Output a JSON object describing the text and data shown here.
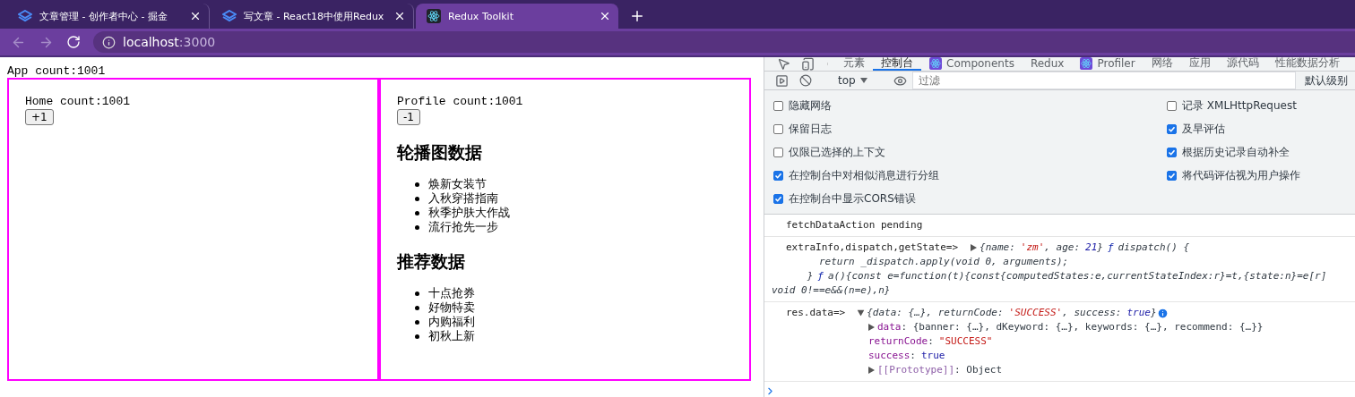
{
  "browser": {
    "tabs": [
      {
        "title": "文章管理 - 创作者中心 - 掘金",
        "selected": false
      },
      {
        "title": "写文章 - React18中使用Redux",
        "selected": false
      },
      {
        "title": "Redux Toolkit",
        "selected": true
      }
    ],
    "address": {
      "host": "localhost",
      "port": ":3000"
    }
  },
  "page": {
    "app_count": "App count:1001",
    "home": {
      "count": "Home count:1001",
      "button": "+1"
    },
    "profile": {
      "count": "Profile count:1001",
      "button": "-1",
      "banner_title": "轮播图数据",
      "banners": [
        "焕新女装节",
        "入秋穿搭指南",
        "秋季护肤大作战",
        "流行抢先一步"
      ],
      "recommend_title": "推荐数据",
      "recommends": [
        "十点抢券",
        "好物特卖",
        "内购福利",
        "初秋上新"
      ]
    }
  },
  "devtools": {
    "tabs": [
      {
        "label": "元素",
        "selected": false
      },
      {
        "label": "控制台",
        "selected": true
      },
      {
        "label": "Components",
        "selected": false
      },
      {
        "label": "Redux",
        "selected": false
      },
      {
        "label": "Profiler",
        "selected": false
      },
      {
        "label": "网络",
        "selected": false
      },
      {
        "label": "应用",
        "selected": false
      },
      {
        "label": "源代码",
        "selected": false
      },
      {
        "label": "性能数据分析",
        "selected": false
      }
    ],
    "toolbar": {
      "context": "top",
      "filter_placeholder": "过滤",
      "levels": "默认级别"
    },
    "settings": {
      "left": [
        {
          "label": "隐藏网络",
          "checked": false
        },
        {
          "label": "保留日志",
          "checked": false
        },
        {
          "label": "仅限已选择的上下文",
          "checked": false
        },
        {
          "label": "在控制台中对相似消息进行分组",
          "checked": true
        },
        {
          "label": "在控制台中显示CORS错误",
          "checked": true
        }
      ],
      "right": [
        {
          "label": "记录 XMLHttpRequest",
          "checked": false
        },
        {
          "label": "及早评估",
          "checked": true
        },
        {
          "label": "根据历史记录自动补全",
          "checked": true
        },
        {
          "label": "将代码评估视为用户操作",
          "checked": true
        }
      ]
    },
    "messages": [
      {
        "lines": [
          {
            "kind": "entry",
            "segments": [
              {
                "kind": "label",
                "text": "fetchDataAction pending"
              }
            ]
          }
        ]
      },
      {
        "lines": [
          {
            "kind": "entry",
            "segments": [
              {
                "kind": "label",
                "text": "extraInfo,dispatch,getState=>"
              },
              {
                "kind": "toggle",
                "expanded": false
              },
              {
                "kind": "plain",
                "text": "{name:"
              },
              {
                "kind": "string",
                "text": "'zm'"
              },
              {
                "kind": "plain",
                "text": ", age:"
              },
              {
                "kind": "number",
                "text": "21"
              },
              {
                "kind": "plain",
                "text": "}"
              },
              {
                "kind": "func",
                "text": "ƒ"
              },
              {
                "kind": "plain",
                "text": "dispatch() {"
              }
            ]
          },
          {
            "kind": "source",
            "segments": [
              {
                "kind": "plain",
                "text": "        return _dispatch.apply(void 0, arguments);"
              }
            ]
          },
          {
            "kind": "source",
            "segments": [
              {
                "kind": "plain",
                "text": "      }"
              },
              {
                "kind": "func",
                "text": "ƒ"
              },
              {
                "kind": "plain",
                "text": "a(){const e=function(t){const{computedStates:e,currentStateIndex:r}=t,{state:n}=e[r]"
              }
            ]
          },
          {
            "kind": "source",
            "segments": [
              {
                "kind": "plain",
                "text": "void 0!==e&&(n=e),n}"
              }
            ]
          }
        ]
      },
      {
        "lines": [
          {
            "kind": "entry",
            "segments": [
              {
                "kind": "label",
                "text": "res.data=>"
              },
              {
                "kind": "toggle",
                "expanded": true
              },
              {
                "kind": "plain",
                "text": "{data: {…}, returnCode:"
              },
              {
                "kind": "string",
                "text": "'SUCCESS'"
              },
              {
                "kind": "plain",
                "text": ", success:"
              },
              {
                "kind": "number",
                "text": "true"
              },
              {
                "kind": "plain",
                "text": "}"
              },
              {
                "kind": "info"
              }
            ]
          },
          {
            "kind": "property",
            "segments": [
              {
                "kind": "toggle",
                "expanded": false
              },
              {
                "kind": "key",
                "text": "data"
              },
              {
                "kind": "plain",
                "text": ": {banner: {…}, dKeyword: {…}, keywords: {…}, recommend: {…}}"
              }
            ]
          },
          {
            "kind": "property",
            "segments": [
              {
                "kind": "key",
                "text": "returnCode"
              },
              {
                "kind": "plain",
                "text": ":"
              },
              {
                "kind": "string",
                "text": "\"SUCCESS\""
              }
            ]
          },
          {
            "kind": "property",
            "segments": [
              {
                "kind": "key",
                "text": "success"
              },
              {
                "kind": "plain",
                "text": ":"
              },
              {
                "kind": "number",
                "text": "true"
              }
            ]
          },
          {
            "kind": "property",
            "segments": [
              {
                "kind": "toggle",
                "expanded": false
              },
              {
                "kind": "proto",
                "text": "[[Prototype]]"
              },
              {
                "kind": "plain",
                "text": ": Object"
              }
            ]
          }
        ]
      }
    ]
  }
}
